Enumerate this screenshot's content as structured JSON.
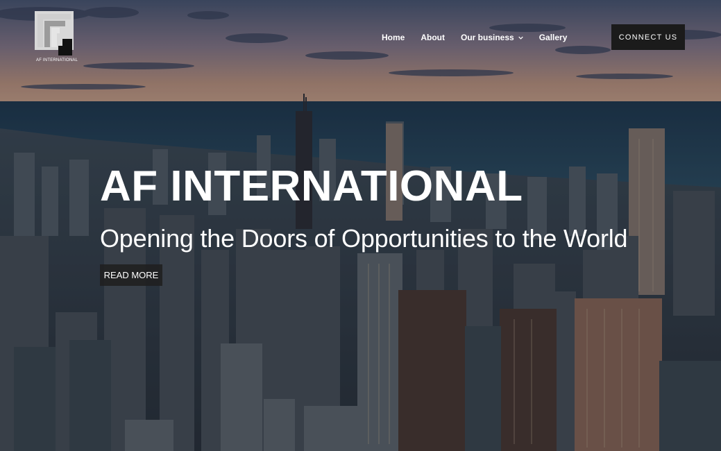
{
  "brand": {
    "logo_text": "AF INTERNATIONAL"
  },
  "nav": {
    "items": [
      {
        "label": "Home"
      },
      {
        "label": "About"
      },
      {
        "label": "Our business",
        "icon": "chevron-down-icon"
      },
      {
        "label": "Gallery"
      }
    ],
    "cta_label": "CONNECT US"
  },
  "hero": {
    "title": "AF INTERNATIONAL",
    "subtitle": "Opening the Doors of Opportunities to the World",
    "button_label": "READ MORE"
  },
  "colors": {
    "cta_background": "#1b1b1b",
    "text": "#ffffff",
    "sky_top": "#5a6a86",
    "sky_horizon": "#c79a7c",
    "lake": "#2c4b62"
  }
}
